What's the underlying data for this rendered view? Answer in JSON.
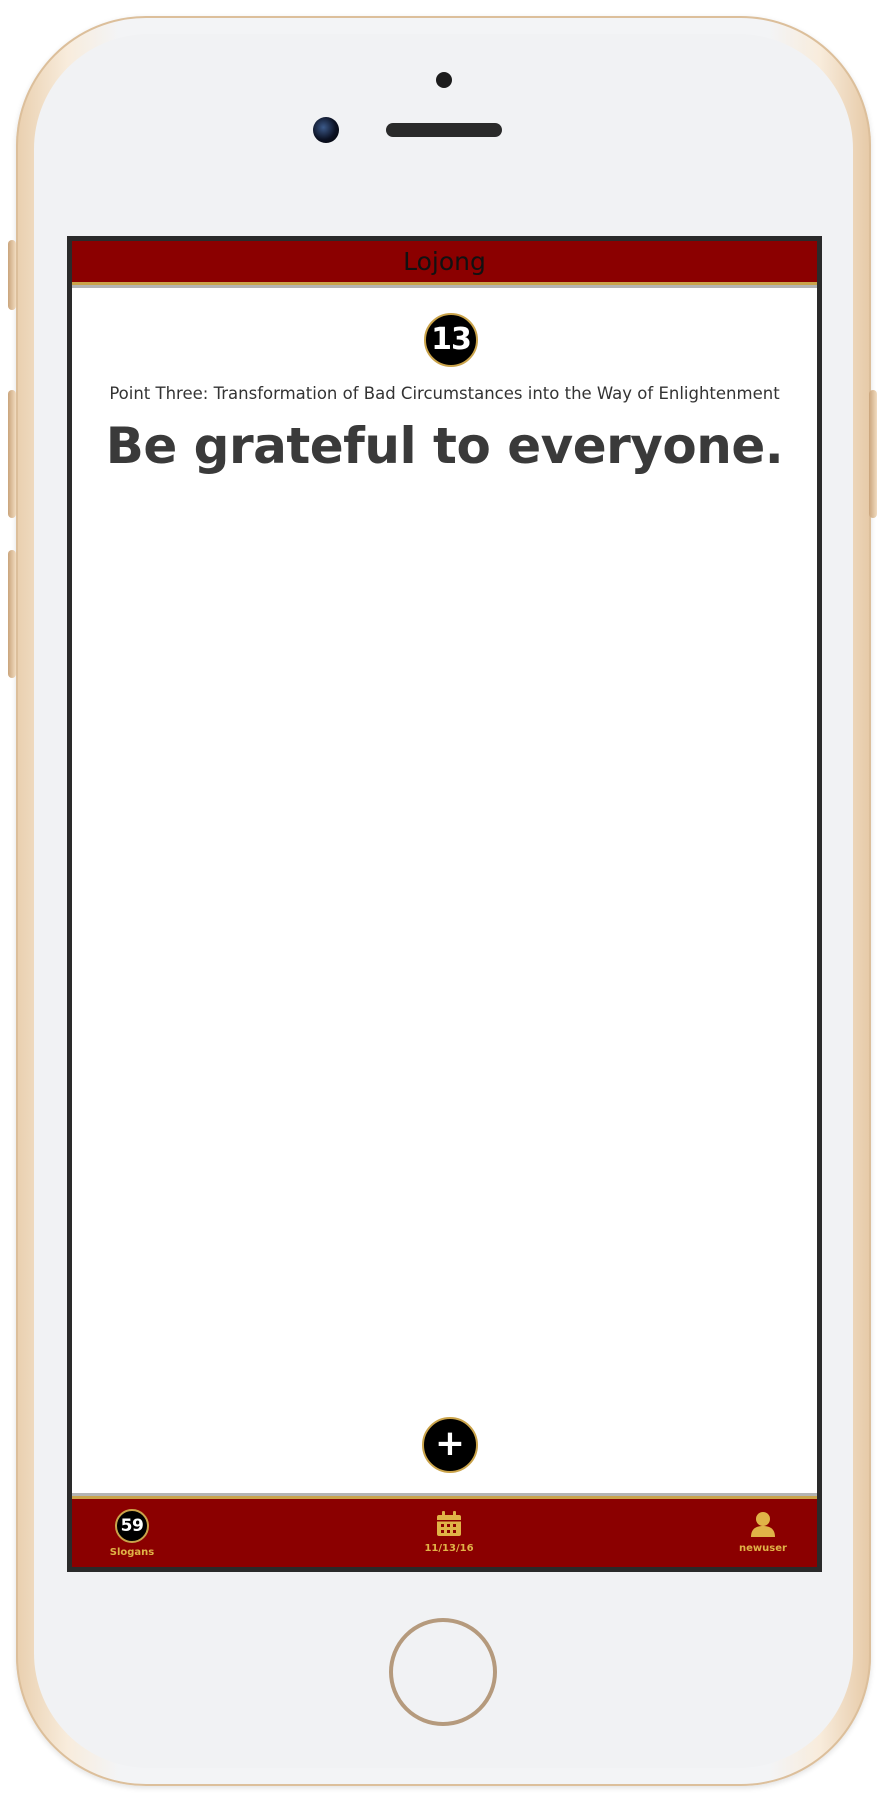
{
  "header": {
    "title": "Lojong"
  },
  "slogan": {
    "number": "13",
    "point": "Point Three: Transformation of Bad Circumstances into the Way of Enlightenment",
    "text": "Be grateful to everyone."
  },
  "actions": {
    "add_label": "+"
  },
  "tab_bar": {
    "slogans": {
      "count": "59",
      "label": "Slogans",
      "icon": "count-badge"
    },
    "date": {
      "label": "11/13/16",
      "icon": "calendar-icon"
    },
    "user": {
      "label": "newuser",
      "icon": "user-icon"
    }
  },
  "colors": {
    "header_background": "#8b0000",
    "accent_gold": "#caa34a",
    "label_gold": "#e0b347",
    "badge_background": "#000000"
  }
}
